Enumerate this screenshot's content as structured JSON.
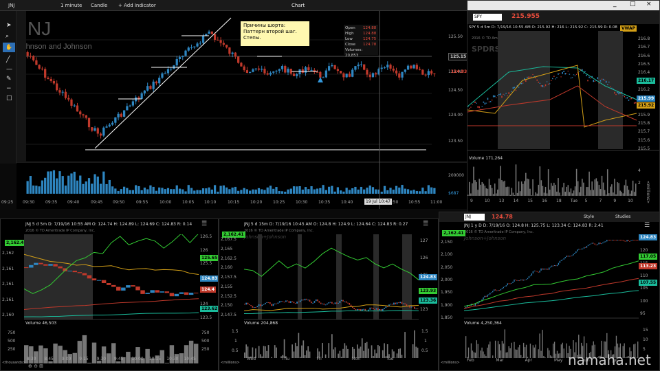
{
  "main_window": {
    "title": "Chart",
    "symbol": "JNJ",
    "interval": "1 minute",
    "chart_type": "Candle",
    "add_indicator": "+ Add Indicator",
    "company": "Johnson and Johnson",
    "annotation_lines": [
      "Причины шорта:",
      "Паттерн второй шаг.",
      "Степы."
    ],
    "ohlc": {
      "open_label": "Open",
      "open": "124.88",
      "high_label": "High",
      "high": "124.88",
      "low_label": "Low",
      "low": "124.75",
      "close_label": "Close",
      "close": "124.78",
      "volume_label": "Volumes:",
      "volume": "20,853"
    },
    "price_ticks": [
      "125.50",
      "125.00",
      "124.50",
      "124.00",
      "123.50"
    ],
    "price_tag_last": "125.15",
    "price_tag_current": "124.83",
    "volume_ticks": [
      "200000",
      "$687"
    ],
    "time_ticks": [
      "09:25",
      "09:30",
      "09:35",
      "09:40",
      "09:45",
      "09:50",
      "09:55",
      "10:00",
      "10:05",
      "10:10",
      "10:15",
      "10:20",
      "10:25",
      "10:30",
      "10:35",
      "10:40",
      "10:45",
      "10:50",
      "10:55",
      "11:00"
    ],
    "time_cursor": "19 Jul 10:47"
  },
  "spy_panel": {
    "symbol": "SPY",
    "price": "215.955",
    "header": "SPY 5 d 5m   D: 7/19/16 10:55 AM   O: 215.92   H: 216   L: 215.92   C: 215.99   R: 0.08",
    "vwap": "VWAP",
    "watermark": "SPDRS",
    "copyright": "2016 © TD Ameritrade IP Company, Inc.",
    "price_ticks": [
      "216.8",
      "216.7",
      "216.6",
      "216.5",
      "216.4",
      "216.3",
      "216.2",
      "216.1",
      "216",
      "215.9",
      "215.8",
      "215.7",
      "215.6",
      "215.5"
    ],
    "tags": [
      "216.17",
      "215.99",
      "215.92"
    ],
    "volume_label": "Volume",
    "volume_value": "171,264",
    "vol_ticks": [
      "4",
      "2"
    ],
    "vol_unit": "<millions>",
    "time_ticks": [
      "9",
      "10",
      "13",
      "14",
      "15",
      "16",
      "18",
      "Tue",
      "5",
      "7",
      "9",
      "10"
    ],
    "window_controls": [
      "_",
      "□",
      "×"
    ]
  },
  "bottom_left": {
    "header": "JNJ 5 d 5m   D: 7/19/16 10:55 AM   O: 124.74   H: 124.89   L: 124.69   C: 124.83   R: 0.14",
    "copyright": "2016 © TD Ameritrade IP Company, Inc.",
    "left_tag": "2,162.41",
    "left_ticks": [
      "2,162",
      "2,161",
      "2,161",
      "2,161",
      "2,160"
    ],
    "right_ticks": [
      "126.5",
      "126",
      "125.5",
      "125",
      "124.5",
      "124",
      "123.5"
    ],
    "tags": [
      "125.65",
      "124.83",
      "124.4",
      "123.62"
    ],
    "volume_label": "Volume",
    "volume_value": "46,503",
    "vol_left_ticks": [
      "750",
      "500",
      "250"
    ],
    "vol_right_ticks": [
      "750",
      "500",
      "250"
    ],
    "vol_unit": "<thousands>",
    "time_ticks": [
      "8:30",
      "8:45",
      "9:00",
      "9:15",
      "9:30",
      "9:45",
      "10:00",
      "10:15",
      "10:30",
      "10:45"
    ]
  },
  "bottom_mid": {
    "header": "JNJ 5 d 15m   D: 7/19/16 10:45 AM   O: 124.8   H: 124.9   L: 124.64   C: 124.83   R: 0.27",
    "copyright": "2016 © TD Ameritrade IP Company, Inc.",
    "watermark": "Johnson+Johnson",
    "left_tag": "2,162.41",
    "left_ticks": [
      "2,167.5",
      "2,165",
      "2,162.5",
      "2,160",
      "2,157.5",
      "2,155",
      "2,152.5",
      "2,150",
      "2,147.5"
    ],
    "right_ticks": [
      "127",
      "126",
      "125",
      "124",
      "123"
    ],
    "tags": [
      "124.83",
      "123.93",
      "123.36"
    ],
    "volume_label": "Volume",
    "volume_value": "204,868",
    "vol_ticks": [
      "1.5",
      "1",
      "0.5"
    ],
    "vol_unit": "<millions>",
    "time_ticks": [
      "Wed",
      "Thu",
      "Fri",
      "Mon",
      "Tue"
    ]
  },
  "bottom_right": {
    "symbol": "JNJ",
    "price": "124.78",
    "header": "JNJ 1 y D   D: 7/19/16   O: 124.8   H: 125.75   L: 123.34   C: 124.83   R: 2.41",
    "style_label": "Style",
    "studies_label": "Studies",
    "copyright": "2016 © TD Ameritrade IP Company, Inc.",
    "watermark": "Johnson+Johnson",
    "left_tag": "2,162.41",
    "left_ticks": [
      "2,150",
      "2,100",
      "2,050",
      "2,000",
      "1,950",
      "1,900",
      "1,850"
    ],
    "right_ticks": [
      "125",
      "120",
      "115",
      "110",
      "105",
      "100",
      "95"
    ],
    "tags": [
      "124.83",
      "117.05",
      "113.23",
      "107.55"
    ],
    "volume_label": "Volume",
    "volume_value": "4,250,364",
    "vol_ticks": [
      "15",
      "10",
      "5"
    ],
    "vol_unit": "<millions>",
    "time_ticks": [
      "Feb",
      "Mar",
      "Apr",
      "May",
      "Jun",
      "Jul"
    ]
  },
  "watermark_site": "namaha.net",
  "colors": {
    "up": "#2e86c1",
    "down": "#c0392b",
    "bg": "#000000",
    "accent_green": "#33cc33",
    "annotation_bg": "#fff8b0"
  }
}
